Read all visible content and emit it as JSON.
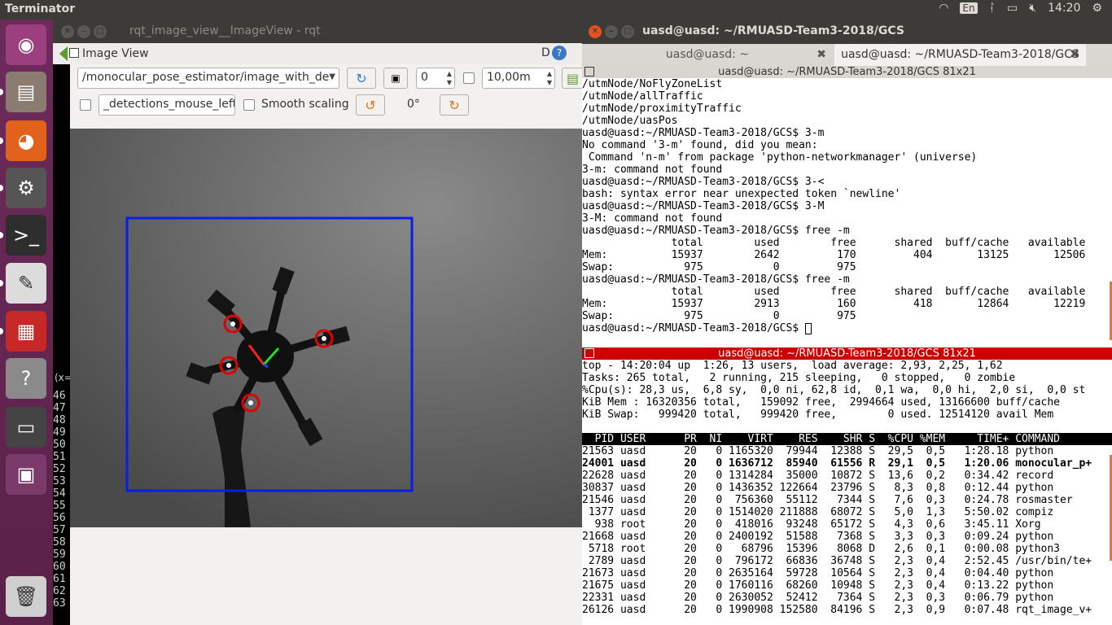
{
  "topbar": {
    "app_title": "Terminator",
    "keyboard": "En",
    "time": "14:20"
  },
  "launcher": {
    "items": [
      {
        "name": "ubuntu-logo-icon",
        "color": "#9c3f7e"
      },
      {
        "name": "files-icon",
        "color": "#8a7c70"
      },
      {
        "name": "firefox-icon",
        "color": "#e2621c"
      },
      {
        "name": "settings-icon",
        "color": "#555555"
      },
      {
        "name": "terminal-icon",
        "color": "#2e2e2e"
      },
      {
        "name": "text-editor-icon",
        "color": "#dcdcdc"
      },
      {
        "name": "terminator-icon",
        "color": "#c62828"
      },
      {
        "name": "help-icon",
        "color": "#8a8a8a"
      },
      {
        "name": "screen-icon",
        "color": "#444444"
      },
      {
        "name": "workspaces-icon",
        "color": "#7a3b6a"
      },
      {
        "name": "trash-icon",
        "color": "#cfcfcf"
      }
    ]
  },
  "rqt": {
    "window_title": "rqt_image_view__ImageView - rqt",
    "dock_title": "Image View",
    "help_btn": "D",
    "topic": "/monocular_pose_estimator/image_with_de",
    "spin_value": "0",
    "scale_value": "10,00m",
    "mouse_topic": "_detections_mouse_left",
    "smooth_label": "Smooth scaling",
    "rotation": "0°",
    "xy_label": "(x=",
    "line_numbers": [
      "46",
      "47",
      "48",
      "49",
      "50",
      "51",
      "52",
      "53",
      "54",
      "55",
      "56",
      "57",
      "58",
      "59",
      "60",
      "61",
      "62",
      "63"
    ]
  },
  "terminal": {
    "window_title": "uasd@uasd: ~/RMUASD-Team3-2018/GCS",
    "tabs": [
      {
        "label": "uasd@uasd: ~",
        "active": false
      },
      {
        "label": "uasd@uasd: ~/RMUASD-Team3-2018/GCS",
        "active": true
      }
    ],
    "pane1_title": "uasd@uasd: ~/RMUASD-Team3-2018/GCS 81x21",
    "pane1_lines": [
      "/utmNode/NoFlyZoneList",
      "/utmNode/allTraffic",
      "/utmNode/proximityTraffic",
      "/utmNode/uasPos",
      "uasd@uasd:~/RMUASD-Team3-2018/GCS$ 3-m",
      "No command '3-m' found, did you mean:",
      " Command 'n-m' from package 'python-networkmanager' (universe)",
      "3-m: command not found",
      "uasd@uasd:~/RMUASD-Team3-2018/GCS$ 3-<",
      "bash: syntax error near unexpected token `newline'",
      "uasd@uasd:~/RMUASD-Team3-2018/GCS$ 3-M",
      "3-M: command not found",
      "uasd@uasd:~/RMUASD-Team3-2018/GCS$ free -m",
      "              total        used        free      shared  buff/cache   available",
      "Mem:          15937        2642         170         404       13125       12506",
      "Swap:           975           0         975",
      "uasd@uasd:~/RMUASD-Team3-2018/GCS$ free -m",
      "              total        used        free      shared  buff/cache   available",
      "Mem:          15937        2913         160         418       12864       12219",
      "Swap:           975           0         975",
      "uasd@uasd:~/RMUASD-Team3-2018/GCS$ "
    ],
    "pane2_title": "uasd@uasd: ~/RMUASD-Team3-2018/GCS 81x21",
    "pane2_summary": [
      "top - 14:20:04 up  1:26, 13 users,  load average: 2,93, 2,25, 1,62",
      "Tasks: 265 total,   2 running, 215 sleeping,   0 stopped,   0 zombie",
      "%Cpu(s): 28,3 us,  6,8 sy,  0,0 ni, 62,8 id,  0,1 wa,  0,0 hi,  2,0 si,  0,0 st",
      "KiB Mem : 16320356 total,   159092 free,  2994664 used, 13166600 buff/cache",
      "KiB Swap:   999420 total,   999420 free,        0 used. 12514120 avail Mem",
      ""
    ],
    "top_header": "  PID USER      PR  NI    VIRT    RES    SHR S  %CPU %MEM     TIME+ COMMAND",
    "processes": [
      {
        "text": "21563 uasd      20   0 1165320  79944  12388 S  29,5  0,5   1:28.18 python",
        "bold": false
      },
      {
        "text": "24001 uasd      20   0 1636712  85940  61556 R  29,1  0,5   1:20.06 monocular_p+",
        "bold": true
      },
      {
        "text": "22628 uasd      20   0 1314284  35000  10872 S  13,6  0,2   0:34.42 record",
        "bold": false
      },
      {
        "text": "30837 uasd      20   0 1436352 122664  23796 S   8,3  0,8   0:12.44 python",
        "bold": false
      },
      {
        "text": "21546 uasd      20   0  756360  55112   7344 S   7,6  0,3   0:24.78 rosmaster",
        "bold": false
      },
      {
        "text": " 1377 uasd      20   0 1514020 211888  68072 S   5,0  1,3   5:50.02 compiz",
        "bold": false
      },
      {
        "text": "  938 root      20   0  418016  93248  65172 S   4,3  0,6   3:45.11 Xorg",
        "bold": false
      },
      {
        "text": "21668 uasd      20   0 2400192  51588   7368 S   3,3  0,3   0:09.24 python",
        "bold": false
      },
      {
        "text": " 5718 root      20   0   68796  15396   8068 D   2,6  0,1   0:00.08 python3",
        "bold": false
      },
      {
        "text": " 2789 uasd      20   0  796172  66836  36748 S   2,3  0,4   2:52.45 /usr/bin/te+",
        "bold": false
      },
      {
        "text": "21673 uasd      20   0 2635164  59728  10564 S   2,3  0,4   0:04.40 python",
        "bold": false
      },
      {
        "text": "21675 uasd      20   0 1760116  68260  10948 S   2,3  0,4   0:13.22 python",
        "bold": false
      },
      {
        "text": "22331 uasd      20   0 2630052  52412   7364 S   2,3  0,3   0:06.79 python",
        "bold": false
      },
      {
        "text": "26126 uasd      20   0 1990908 152580  84196 S   2,3  0,9   0:07.48 rqt_image_v+",
        "bold": false
      }
    ]
  }
}
